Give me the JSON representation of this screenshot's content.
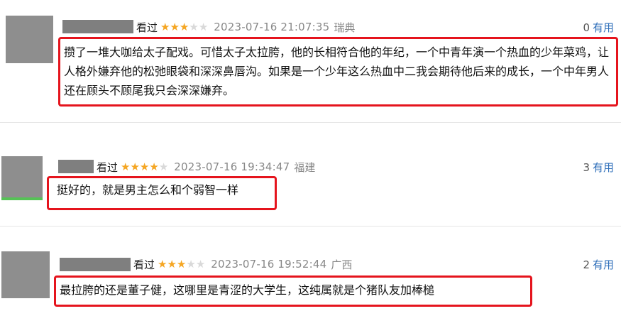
{
  "reviews": [
    {
      "watched": "看过",
      "rating": 3,
      "time": "2023-07-16 21:07:35",
      "location": "瑞典",
      "useful_count": "0",
      "useful_label": "有用",
      "comment": "攒了一堆大咖给太子配戏。可惜太子太拉胯，他的长相符合他的年纪，一个中青年演一个热血的少年菜鸡，让人格外嫌弃他的松弛眼袋和深深鼻唇沟。如果是一个少年这么热血中二我会期待他后来的成长，一个中年男人还在顾头不顾尾我只会深深嫌弃。"
    },
    {
      "watched": "看过",
      "rating": 4,
      "time": "2023-07-16 19:34:47",
      "location": "福建",
      "useful_count": "3",
      "useful_label": "有用",
      "comment": "挺好的，就是男主怎么和个弱智一样"
    },
    {
      "watched": "看过",
      "rating": 3,
      "time": "2023-07-16 19:52:44",
      "location": "广西",
      "useful_count": "2",
      "useful_label": "有用",
      "comment": "最拉胯的还是董子健，这哪里是青涩的大学生，这纯属就是个猪队友加棒槌"
    }
  ],
  "colors": {
    "highlight_frame": "#e5141d",
    "star_on": "#f5a623",
    "star_off": "#d9d9d9",
    "link": "#2f6fba"
  },
  "icons": [
    "star-icon"
  ]
}
